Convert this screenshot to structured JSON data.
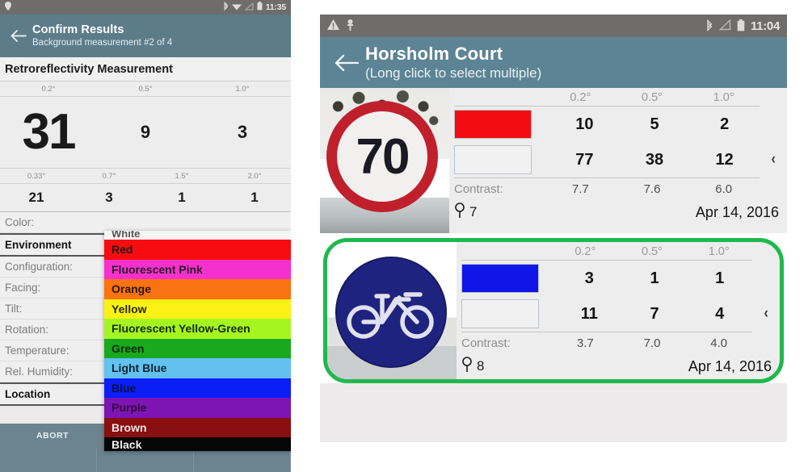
{
  "left_phone": {
    "statusbar": {
      "icons_left": [
        "location-pin-icon"
      ],
      "icons_right": [
        "bluetooth-icon",
        "wifi-icon",
        "signal-icon",
        "battery-icon"
      ],
      "time": "11:35"
    },
    "appbar": {
      "back_icon": "back-arrow-icon",
      "title": "Confirm Results",
      "subtitle": "Background measurement #2 of 4"
    },
    "section_title": "Retroreflectivity Measurement",
    "measurement_table": {
      "headers_row1": [
        "0.2°",
        "0.5°",
        "1.0°"
      ],
      "values_row1": [
        "31",
        "9",
        "3"
      ],
      "headers_row2": [
        "0.33°",
        "0.7°",
        "1.5°",
        "2.0°"
      ],
      "values_row2": [
        "21",
        "3",
        "1",
        "1"
      ]
    },
    "fields": [
      {
        "label": "Color:",
        "bold": false
      },
      {
        "label": "Environment",
        "bold": true
      },
      {
        "label": "Configuration:",
        "bold": false
      },
      {
        "label": "Facing:",
        "bold": false
      },
      {
        "label": "Tilt:",
        "bold": false
      },
      {
        "label": "Rotation:",
        "bold": false
      },
      {
        "label": "Temperature:",
        "bold": false
      },
      {
        "label": "Rel. Humidity:",
        "bold": false
      },
      {
        "label": "Location",
        "bold": true
      }
    ],
    "color_dropdown": {
      "clipped_top_label": "White",
      "options": [
        {
          "label": "Red",
          "bg": "#f70c10",
          "fg": "#1a1a1a"
        },
        {
          "label": "Fluorescent Pink",
          "bg": "#f431cd",
          "fg": "#2a1a2a"
        },
        {
          "label": "Orange",
          "bg": "#fa7312",
          "fg": "#2a1505"
        },
        {
          "label": "Yellow",
          "bg": "#fbf215",
          "fg": "#2a2605"
        },
        {
          "label": "Fluorescent Yellow-Green",
          "bg": "#a5f520",
          "fg": "#162a05"
        },
        {
          "label": "Green",
          "bg": "#1aa81e",
          "fg": "#0b2a0c"
        },
        {
          "label": "Light Blue",
          "bg": "#62c1ef",
          "fg": "#10232d"
        },
        {
          "label": "Blue",
          "bg": "#0b1ef5",
          "fg": "#0a1040"
        },
        {
          "label": "Purple",
          "bg": "#7d15b5",
          "fg": "#33063f"
        },
        {
          "label": "Brown",
          "bg": "#8a0f10",
          "fg": "#f6e6e6"
        },
        {
          "label": "Black",
          "bg": "#060606",
          "fg": "#f0f0f0"
        }
      ]
    },
    "abort_button": "ABORT"
  },
  "right_phone": {
    "statusbar": {
      "icons_left": [
        "warning-triangle-icon",
        "usb-icon"
      ],
      "icons_right": [
        "bluetooth-icon",
        "signal-icon",
        "battery-icon"
      ],
      "time": "11:04"
    },
    "appbar": {
      "back_icon": "back-arrow-icon",
      "title": "Horsholm Court",
      "subtitle": "(Long click to select multiple)"
    },
    "column_headers": [
      "0.2°",
      "0.5°",
      "1.0°"
    ],
    "contrast_label": "Contrast:",
    "chevron_icon": "chevron-left-icon",
    "pin_icon": "location-pin-icon",
    "cards": [
      {
        "selected": false,
        "thumbnail": "speed-limit-70-sign",
        "sign_text": "70",
        "color_swatch": "#f30d12",
        "color_swatch_name": "red",
        "second_swatch": "#f2f1f1",
        "second_swatch_name": "white",
        "row1_values": [
          "10",
          "5",
          "2"
        ],
        "row2_values": [
          "77",
          "38",
          "12"
        ],
        "contrast_values": [
          "7.7",
          "7.6",
          "6.0"
        ],
        "pin_count": "7",
        "date": "Apr 14, 2016"
      },
      {
        "selected": true,
        "thumbnail": "bicycle-route-sign",
        "sign_text": "",
        "color_swatch": "#1016e8",
        "color_swatch_name": "blue",
        "second_swatch": "#f2f1f1",
        "second_swatch_name": "white",
        "row1_values": [
          "3",
          "1",
          "1"
        ],
        "row2_values": [
          "11",
          "7",
          "4"
        ],
        "contrast_values": [
          "3.7",
          "7.0",
          "4.0"
        ],
        "pin_count": "8",
        "date": "Apr 14, 2016"
      }
    ],
    "selection_color": "#1fb84e"
  }
}
